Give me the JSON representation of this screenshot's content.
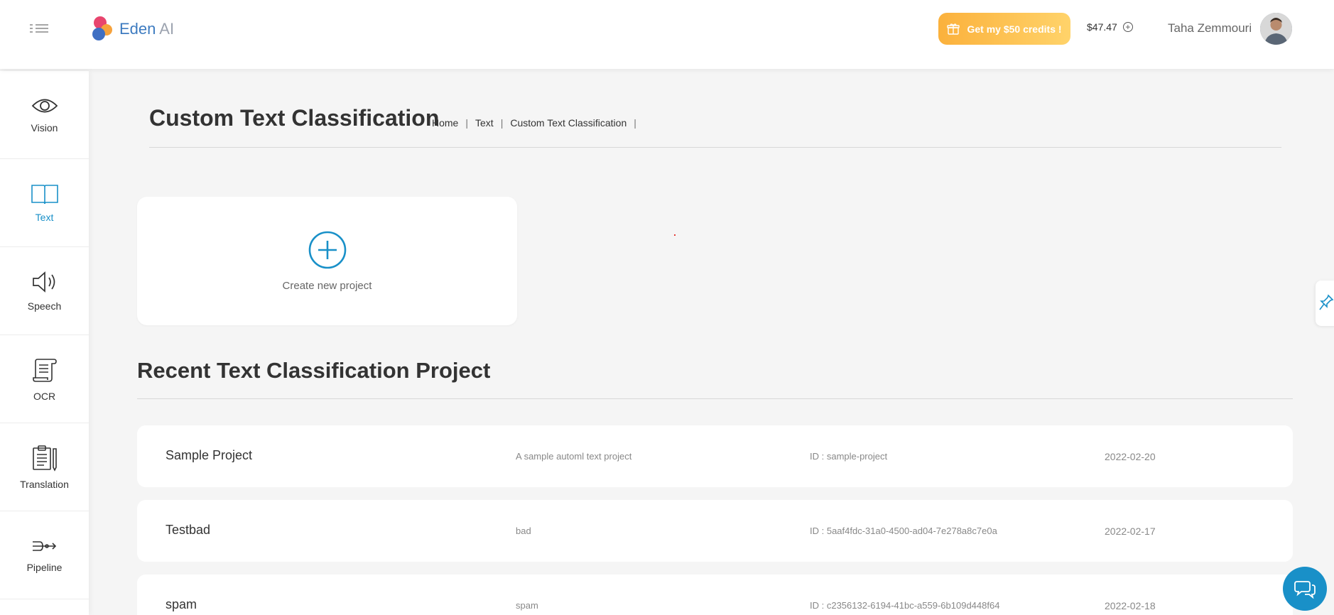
{
  "header": {
    "logo_name": "Eden",
    "logo_suffix": "AI",
    "credits_button": "Get my $50 credits !",
    "balance": "$47.47",
    "user_name": "Taha Zemmouri"
  },
  "sidebar": {
    "items": [
      {
        "label": "Vision",
        "icon": "eye-icon",
        "active": false
      },
      {
        "label": "Text",
        "icon": "book-icon",
        "active": true
      },
      {
        "label": "Speech",
        "icon": "speaker-icon",
        "active": false
      },
      {
        "label": "OCR",
        "icon": "scroll-icon",
        "active": false
      },
      {
        "label": "Translation",
        "icon": "clipboard-icon",
        "active": false
      },
      {
        "label": "Pipeline",
        "icon": "pipeline-icon",
        "active": false
      }
    ]
  },
  "page": {
    "title": "Custom Text Classification",
    "breadcrumb": [
      "Home",
      "Text",
      "Custom Text Classification"
    ],
    "create_label": "Create new project",
    "section_title": "Recent Text Classification Project"
  },
  "projects": [
    {
      "name": "Sample Project",
      "description": "A sample automl text project",
      "id": "ID : sample-project",
      "date": "2022-02-20"
    },
    {
      "name": "Testbad",
      "description": "bad",
      "id": "ID : 5aaf4fdc-31a0-4500-ad04-7e278a8c7e0a",
      "date": "2022-02-17"
    },
    {
      "name": "spam",
      "description": "spam",
      "id": "ID : c2356132-6194-41bc-a559-6b109d448f64",
      "date": "2022-02-18"
    }
  ],
  "colors": {
    "accent": "#1990c8",
    "credits_gradient_start": "#fbb13c",
    "credits_gradient_end": "#ffd36a"
  }
}
